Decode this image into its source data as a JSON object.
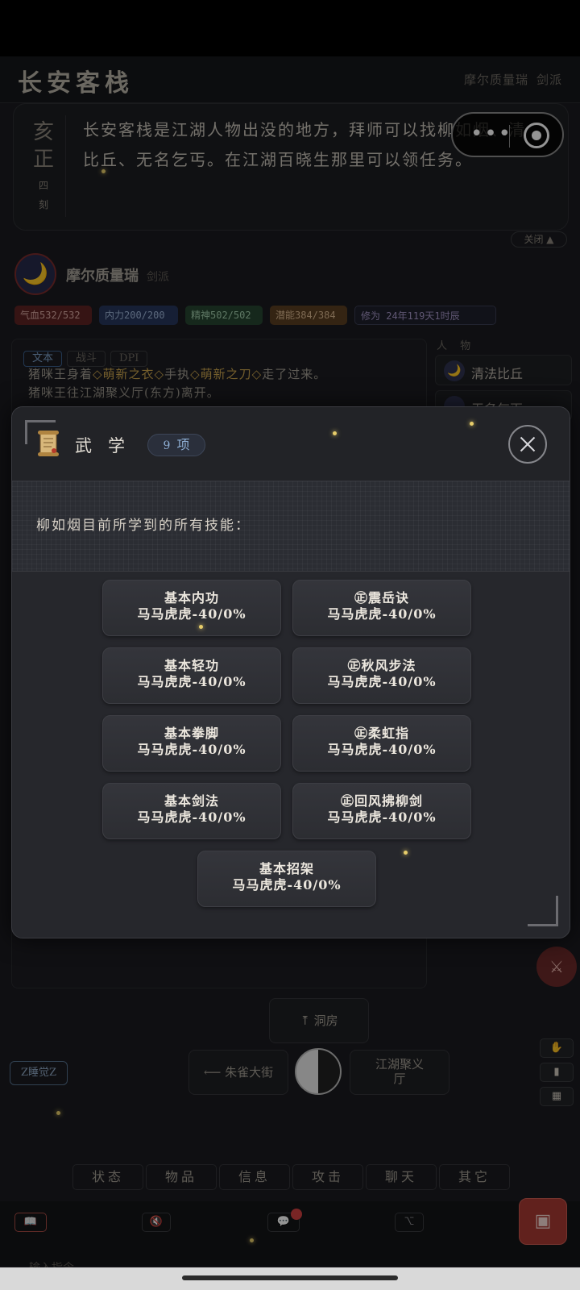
{
  "header": {
    "title": "长安客栈",
    "user_name": "摩尔质量瑞",
    "user_sect": "剑派"
  },
  "time": {
    "big_1": "亥",
    "big_2": "正",
    "small_1": "四",
    "small_2": "刻"
  },
  "location_description": {
    "line1": "长安客栈是江湖人物出没的地方，拜师可以找柳如烟、清",
    "line2": "比丘、无名乞丐。在江湖百晓生那里可以领任务。"
  },
  "mini_program": {
    "more_icon": "•••"
  },
  "close_toggle": {
    "label": "关闭 ▲"
  },
  "player": {
    "avatar_icon": "🌙",
    "name": "摩尔质量瑞",
    "sect": "剑派"
  },
  "stats": {
    "hp": "气血532/532",
    "mp": "内力200/200",
    "spirit": "精神502/502",
    "potential": "潜能384/384",
    "cultivation": "修为 24年119天1时辰"
  },
  "log": {
    "tabs": [
      "文本",
      "战斗",
      "DPI"
    ],
    "line1": {
      "a": "猪咪王身着",
      "b": "◇萌新之衣◇",
      "c": "手执",
      "d": "◇萌新之刀◇",
      "e": "走了过来。"
    },
    "line2": "猪咪王往江湖聚义厅(东方)离开。"
  },
  "npcs": {
    "title": "人 物",
    "items": [
      {
        "icon": "🌙",
        "name": "清法比丘"
      },
      {
        "icon": "",
        "name": "无名乞丐"
      }
    ]
  },
  "modal": {
    "title": "武学",
    "count_number": "9",
    "count_unit": "项",
    "intro": "柳如烟目前所学到的所有技能：",
    "skills": [
      {
        "name": "基本内功",
        "level": "马马虎虎-40/0%"
      },
      {
        "name": "㊣震岳诀",
        "level": "马马虎虎-40/0%"
      },
      {
        "name": "基本轻功",
        "level": "马马虎虎-40/0%"
      },
      {
        "name": "㊣秋风步法",
        "level": "马马虎虎-40/0%"
      },
      {
        "name": "基本拳脚",
        "level": "马马虎虎-40/0%"
      },
      {
        "name": "㊣柔虹指",
        "level": "马马虎虎-40/0%"
      },
      {
        "name": "基本剑法",
        "level": "马马虎虎-40/0%"
      },
      {
        "name": "㊣回风拂柳剑",
        "level": "马马虎虎-40/0%"
      },
      {
        "name": "基本招架",
        "level": "马马虎虎-40/0%"
      }
    ]
  },
  "directions": {
    "up": "⤒ 洞房",
    "west": "⟵ 朱雀大街",
    "east_line1": "江湖聚义",
    "east_line2": "厅"
  },
  "sleep_button": "Z睡觉Z",
  "menu": [
    "状态",
    "物品",
    "信息",
    "攻击",
    "聊天",
    "其它"
  ],
  "command_hint": "输入指令",
  "colors": {
    "accent_blue": "#8fb0d6",
    "highlight_gold": "#c9a24c",
    "send_red": "#a83a32"
  }
}
